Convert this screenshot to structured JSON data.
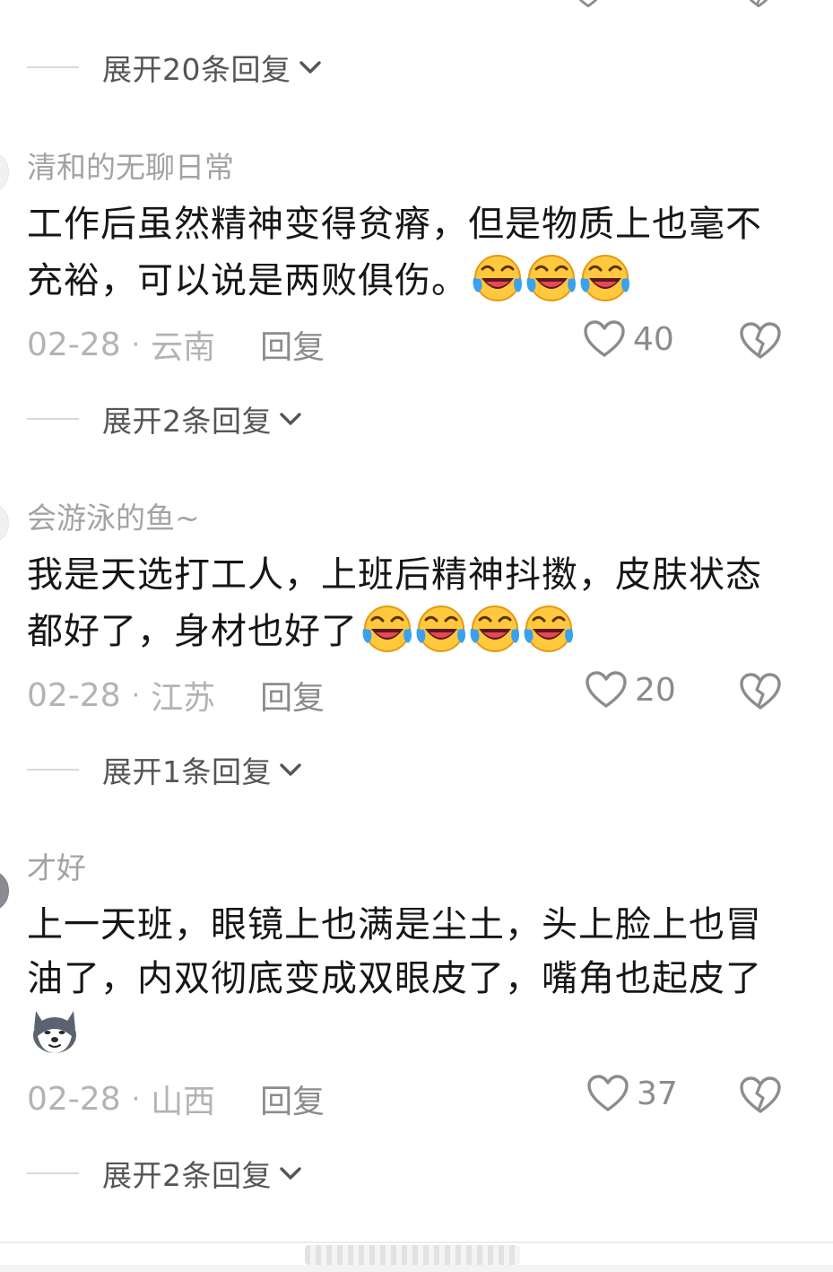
{
  "top_expand": {
    "label": "展开20条回复"
  },
  "comments": [
    {
      "username": "清和的无聊日常",
      "text": "工作后虽然精神变得贫瘠，但是物质上也毫不充裕，可以说是两败俱伤。",
      "emojis": [
        "laugh-cry-emoji",
        "laugh-cry-emoji",
        "laugh-cry-emoji"
      ],
      "date": "02-28",
      "location": "云南",
      "reply_label": "回复",
      "likes": "40",
      "expand_label": "展开2条回复"
    },
    {
      "username": "会游泳的鱼~",
      "text": "我是天选打工人，上班后精神抖擞，皮肤状态都好了，身材也好了",
      "emojis": [
        "laugh-cry-emoji",
        "laugh-cry-emoji",
        "laugh-cry-emoji",
        "laugh-cry-emoji"
      ],
      "date": "02-28",
      "location": "江苏",
      "reply_label": "回复",
      "likes": "20",
      "expand_label": "展开1条回复"
    },
    {
      "username": "才好",
      "text": "上一天班，眼镜上也满是尘土，头上脸上也冒油了，内双彻底变成双眼皮了，嘴角也起皮了",
      "emojis": [
        "husky-dog-emoji"
      ],
      "date": "02-28",
      "location": "山西",
      "reply_label": "回复",
      "likes": "37",
      "expand_label": "展开2条回复"
    }
  ],
  "meta_separator": "·",
  "colors": {
    "username": "#a3a3a3",
    "meta": "#b3b3b3",
    "icon_stroke": "#8c8c8c",
    "emoji_face": "#ffc83d",
    "emoji_tear": "#3aa0f0"
  }
}
